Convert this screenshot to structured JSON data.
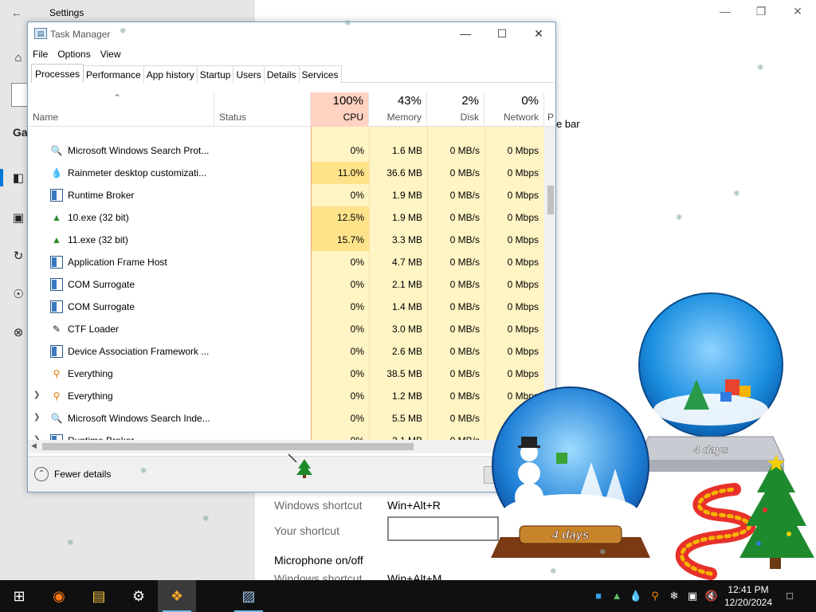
{
  "settings": {
    "title": "Settings",
    "partial_nav_label": "Ga",
    "partial_bar_text": "e bar",
    "windows_shortcut_label": "Windows shortcut",
    "windows_shortcut_value": "Win+Alt+R",
    "your_shortcut_label": "Your shortcut",
    "your_shortcut_value": "",
    "section_title": "Microphone on/off",
    "windows_shortcut_label_2": "Windows shortcut",
    "windows_shortcut_value_2": "Win+Alt+M"
  },
  "task_manager": {
    "title": "Task Manager",
    "menu": [
      "File",
      "Options",
      "View"
    ],
    "tabs": [
      "Processes",
      "Performance",
      "App history",
      "Startup",
      "Users",
      "Details",
      "Services"
    ],
    "active_tab": "Processes",
    "columns": {
      "name": "Name",
      "status": "Status",
      "cpu": {
        "pct": "100%",
        "label": "CPU"
      },
      "memory": {
        "pct": "43%",
        "label": "Memory"
      },
      "disk": {
        "pct": "2%",
        "label": "Disk"
      },
      "network": {
        "pct": "0%",
        "label": "Network"
      },
      "power_partial": "P"
    },
    "rows": [
      {
        "name": "Microsoft Windows Search Prot...",
        "icon": "search-indexer-icon",
        "expand": false,
        "cpu": "0%",
        "memory": "1.6 MB",
        "disk": "0 MB/s",
        "network": "0 Mbps"
      },
      {
        "name": "Rainmeter desktop customizati...",
        "icon": "rainmeter-icon",
        "expand": false,
        "cpu": "11.0%",
        "memory": "36.6 MB",
        "disk": "0 MB/s",
        "network": "0 Mbps"
      },
      {
        "name": "Runtime Broker",
        "icon": "window-app-icon",
        "expand": false,
        "cpu": "0%",
        "memory": "1.9 MB",
        "disk": "0 MB/s",
        "network": "0 Mbps"
      },
      {
        "name": "10.exe (32 bit)",
        "icon": "tree-app-icon",
        "expand": false,
        "cpu": "12.5%",
        "memory": "1.9 MB",
        "disk": "0 MB/s",
        "network": "0 Mbps"
      },
      {
        "name": "11.exe (32 bit)",
        "icon": "tree-app-icon",
        "expand": false,
        "cpu": "15.7%",
        "memory": "3.3 MB",
        "disk": "0 MB/s",
        "network": "0 Mbps"
      },
      {
        "name": "Application Frame Host",
        "icon": "window-app-icon",
        "expand": false,
        "cpu": "0%",
        "memory": "4.7 MB",
        "disk": "0 MB/s",
        "network": "0 Mbps"
      },
      {
        "name": "COM Surrogate",
        "icon": "window-app-icon",
        "expand": false,
        "cpu": "0%",
        "memory": "2.1 MB",
        "disk": "0 MB/s",
        "network": "0 Mbps"
      },
      {
        "name": "COM Surrogate",
        "icon": "window-app-icon",
        "expand": false,
        "cpu": "0%",
        "memory": "1.4 MB",
        "disk": "0 MB/s",
        "network": "0 Mbps"
      },
      {
        "name": "CTF Loader",
        "icon": "ctf-loader-icon",
        "expand": false,
        "cpu": "0%",
        "memory": "3.0 MB",
        "disk": "0 MB/s",
        "network": "0 Mbps"
      },
      {
        "name": "Device Association Framework ...",
        "icon": "window-app-icon",
        "expand": false,
        "cpu": "0%",
        "memory": "2.6 MB",
        "disk": "0 MB/s",
        "network": "0 Mbps"
      },
      {
        "name": "Everything",
        "icon": "everything-icon",
        "expand": false,
        "cpu": "0%",
        "memory": "38.5 MB",
        "disk": "0 MB/s",
        "network": "0 Mbps"
      },
      {
        "name": "Everything",
        "icon": "everything-icon",
        "expand": true,
        "cpu": "0%",
        "memory": "1.2 MB",
        "disk": "0 MB/s",
        "network": "0 Mbps"
      },
      {
        "name": "Microsoft Windows Search Inde...",
        "icon": "search-indexer-icon",
        "expand": true,
        "cpu": "0%",
        "memory": "5.5 MB",
        "disk": "0 MB/s",
        "network": ""
      },
      {
        "name": "Runtime Broker",
        "icon": "window-app-icon",
        "expand": true,
        "cpu": "0%",
        "memory": "2.1 MB",
        "disk": "0 MB/s",
        "network": ""
      }
    ],
    "fewer_details": "Fewer details"
  },
  "decorations": {
    "globe_label_1": "4 days",
    "globe_label_2": "4 days"
  },
  "taskbar": {
    "items": [
      "windows-start-icon",
      "firefox-icon",
      "file-explorer-icon",
      "settings-gear-icon",
      "app-icon",
      "task-manager-icon"
    ],
    "tray_icons": [
      "rainmeter-tray-icon",
      "tree-tray-icon",
      "drop-tray-icon",
      "search-tray-icon",
      "snowflake-tray-icon",
      "network-icon",
      "volume-muted-icon"
    ],
    "time": "12:41 PM",
    "date": "12/20/2024"
  }
}
